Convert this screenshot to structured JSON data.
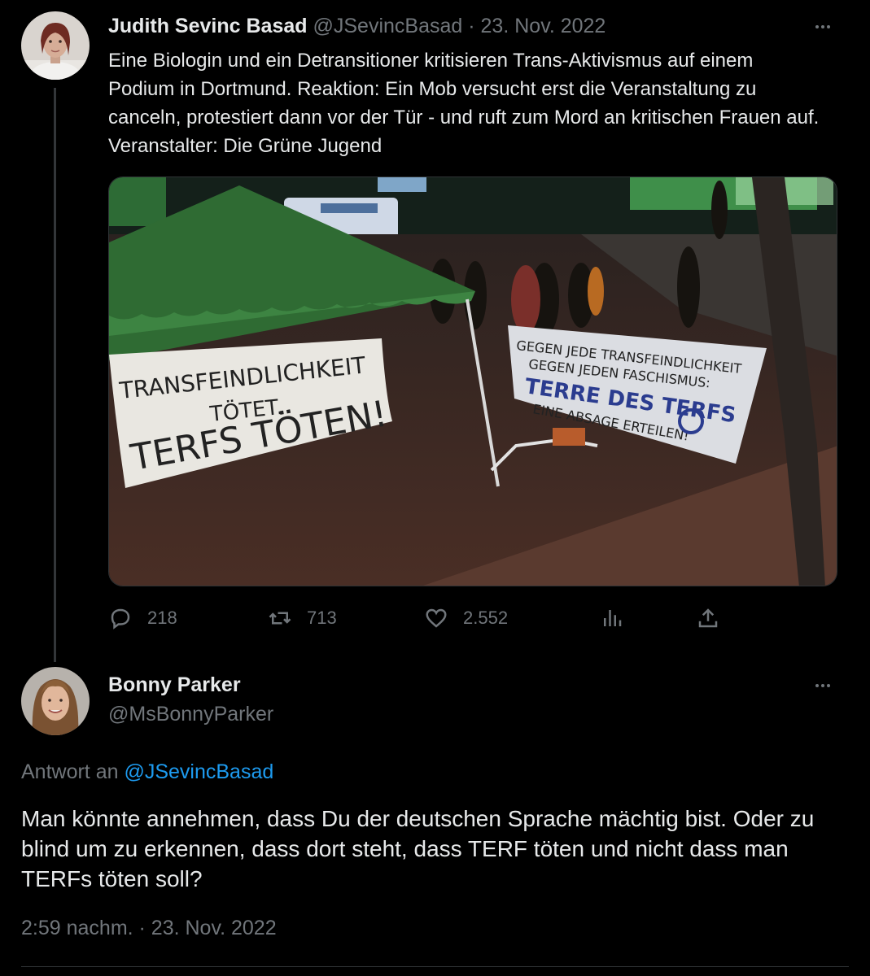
{
  "tweet": {
    "author_name": "Judith Sevinc Basad",
    "author_handle": "@JSevincBasad",
    "separator": "·",
    "date": "23. Nov. 2022",
    "text": "Eine Biologin und ein Detransitioner kritisieren Trans-Aktivismus auf einem Podium in Dortmund. Reaktion: Ein Mob versucht erst die Veranstaltung zu canceln, protestiert dann vor der Tür - und ruft zum Mord an kritischen Frauen auf. Veranstalter: Die Grüne Jugend",
    "media": {
      "banner_left": [
        "TRANSFEINDLICHKEIT",
        "TÖTET.",
        "TERFS TÖTEN!"
      ],
      "banner_right": [
        "GEGEN JEDE TRANSFEINDLICHKEIT",
        "GEGEN JEDEN FASCHISMUS:",
        "TERRE DES TERFS",
        "EINE ABSAGE ERTEILEN!"
      ]
    },
    "actions": {
      "replies": "218",
      "retweets": "713",
      "likes": "2.552"
    }
  },
  "reply": {
    "author_name": "Bonny Parker",
    "author_handle": "@MsBonnyParker",
    "reply_prefix": "Antwort an",
    "reply_to": "@JSevincBasad",
    "text": "Man könnte annehmen, dass Du der deutschen Sprache  mächtig bist. Oder zu blind um zu erkennen, dass dort steht, dass TERF töten und nicht dass man TERFs töten soll?",
    "timestamp": "2:59 nachm. · 23. Nov. 2022"
  },
  "icons": [
    "reply-icon",
    "retweet-icon",
    "like-icon",
    "views-icon",
    "share-icon",
    "more-icon"
  ],
  "colors": {
    "background": "#000000",
    "text": "#e7e9ea",
    "muted": "#71767b",
    "link": "#1d9bf0"
  }
}
